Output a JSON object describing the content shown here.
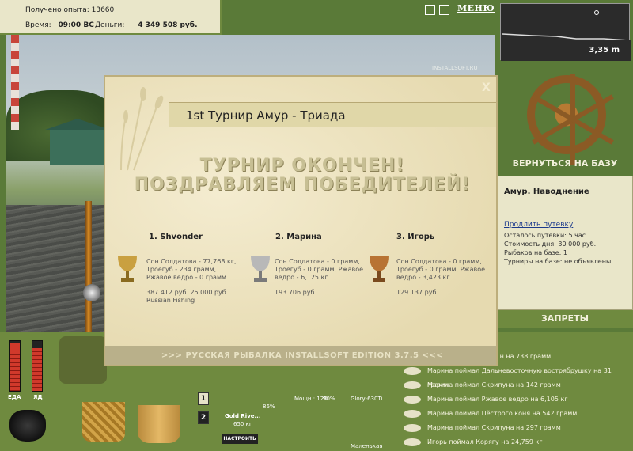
{
  "stats": {
    "exp_label": "Получено опыта:",
    "exp_value": "13660",
    "time_label": "Время:",
    "time_value": "09:00 ВС",
    "money_label": "Деньги:",
    "money_value": "4 349 508 руб."
  },
  "top_controls": {
    "pause_icon": "pause-icon",
    "sound_icon": "sound-icon",
    "menu_label": "МЕНЮ"
  },
  "scene": {
    "watermark": "INSTALLSOFT.RU"
  },
  "depth": {
    "value": "3,35 m"
  },
  "right_panel": {
    "back_to_base": "ВЕРНУТЬСЯ НА БАЗУ",
    "base_title": "Амур. Наводнение",
    "extend_link": "Продлить путевку",
    "lines": [
      "Осталось путевки: 5 час.",
      "Стоимость дня: 30 000 руб.",
      "Рыбаков на базе: 1",
      "Турниры на базе: не объявлены"
    ],
    "bans": "ЗАПРЕТЫ"
  },
  "catch_log": [
    "Марина поймал Ско...н на 738 грамм",
    "Марина поймал Дальневосточную вострябрушку на 31 грамм",
    "Марина поймал Скрипуна на 142 грамм",
    "Марина поймал Ржавое ведро на 6,105 кг",
    "Марина поймал Пёстрого коня на 542 грамм",
    "Марина поймал Скрипуна на 297 грамм",
    "Игорь поймал Корягу на 24,759 кг"
  ],
  "inventory": {
    "meter_food": "ЕДА",
    "meter_poison": "ЯД",
    "food_level_pct": 95,
    "poison_level_pct": 85,
    "btn_1": "1",
    "btn_2": "2",
    "rod_name": "Gold Rive...",
    "rod_length": "650 кг",
    "setup_button": "НАСТРОИТЬ",
    "rod_pct": "86%",
    "line_info": "Мощн.: 120",
    "line_pct": "90%",
    "lure_name": "Glory-630Ti",
    "lure_size": "Маленькая"
  },
  "modal": {
    "title": "1st Турнир Амур - Триада",
    "close": "X",
    "banner_line1": "ТУРНИР ОКОНЧЕН!",
    "banner_line2": "ПОЗДРАВЛЯЕМ ПОБЕДИТЕЛЕЙ!",
    "winners": [
      {
        "place": "1. Shvonder",
        "detail": "Сон Солдатова - 77,768 кг, Троегуб - 234 грамм, Ржавое ведро - 0 грамм",
        "prize": "387 412 руб. 25 000 руб.",
        "extra": "Russian Fishing",
        "cup_color": "#c9a040"
      },
      {
        "place": "2. Марина",
        "detail": "Сон Солдатова - 0 грамм, Троегуб - 0 грамм, Ржавое ведро - 6,125 кг",
        "prize": "193 706 руб.",
        "extra": "",
        "cup_color": "#b8b8b8"
      },
      {
        "place": "3. Игорь",
        "detail": "Сон Солдатова - 0 грамм, Троегуб - 0 грамм, Ржавое ведро - 3,423 кг",
        "prize": "129 137 руб.",
        "extra": "",
        "cup_color": "#b87333"
      }
    ],
    "footer": ">>> РУССКАЯ РЫБАЛКА INSTALLSOFT EDITION 3.7.5 <<<"
  }
}
